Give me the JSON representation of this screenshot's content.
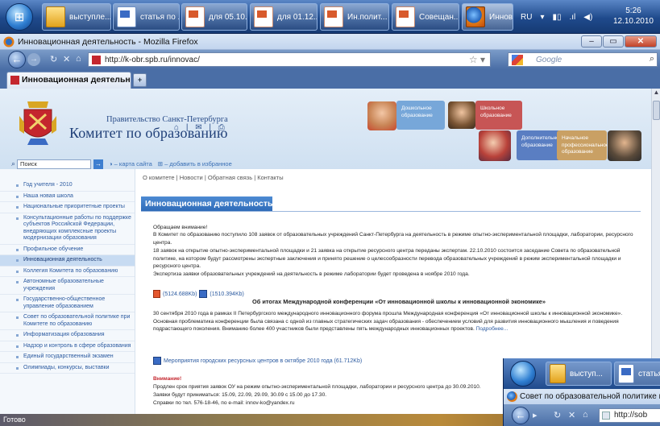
{
  "taskbar": {
    "items": [
      {
        "label": "выступле...",
        "icon": "folder-icon"
      },
      {
        "label": "статья по ...",
        "icon": "word-doc-icon"
      },
      {
        "label": "для 05.10...",
        "icon": "powerpoint-icon"
      },
      {
        "label": "для 01.12...",
        "icon": "powerpoint-icon"
      },
      {
        "label": "Ин.полит...",
        "icon": "powerpoint-icon"
      },
      {
        "label": "Совещан...",
        "icon": "powerpoint-icon"
      },
      {
        "label": "Инновац...",
        "icon": "firefox-icon"
      }
    ],
    "lang": "RU",
    "time": "5:26",
    "date": "12.10.2010"
  },
  "window": {
    "title": "Инновационная деятельность - Mozilla Firefox",
    "url": "http://k-obr.spb.ru/innovac/",
    "search_placeholder": "Google",
    "tab_label": "Инновационная деятельно...",
    "status": "Готово"
  },
  "site": {
    "gov": "Правительство Санкт-Петербурга",
    "committee": "Комитет по образованию",
    "header_icons": "⌂ | ✉ | ⎙",
    "search_value": "Поиск",
    "sitemap": "– карта сайта",
    "favorites": "– добавить в избранное",
    "boxes": [
      "Дошкольное образование",
      "Школьное образование",
      "Дополнительное образование",
      "Начальное профессиональное образование"
    ],
    "topnav": "О комитете | Новости | Обратная связь | Контакты",
    "sidebar": [
      "Год учителя - 2010",
      "Наша новая школа",
      "Национальные приоритетные проекты",
      "Консультационные работы по поддержке субъектов Российской Федерации, внедряющих комплексные проекты модернизации образования",
      "Профильное обучение",
      "Инновационная деятельность",
      "Коллегия Комитета по образованию",
      "Автономные образовательные учреждения",
      "Государственно-общественное управление образованием",
      "Совет по образовательной политике при Комитете по образованию",
      "Информатизация образования",
      "Надзор и контроль в сфере образования",
      "Единый государственный экзамен",
      "Олимпиады, конкурсы, выставки"
    ],
    "active_index": 5,
    "page_title": "Инновационная деятельность",
    "attention": "Обращаем внимание!",
    "p1": "В Комитет по образованию поступило 108 заявок от образовательных учреждений Санкт-Петербурга на деятельность в режиме опытно-экспериментальной площадки, лаборатории, ресурсного центра.",
    "p2": "18 заявок на открытие опытно-экспериментальной площадки и 21 заявка на открытие ресурсного центра переданы экспертам. 22.10.2010 состоится заседание Совета по образовательной политике, на котором будут рассмотрены экспертные заключения и принято решение о целесообразности перевода образовательных учреждений в режим экспериментальной площадки и ресурсного центра.",
    "p3": "Экспертиза заявки образовательных учреждений на деятельность в режиме лаборатории будет проведена в ноябре 2010 года.",
    "file1": "(5124.688Kb)",
    "file2": "(1510.394Kb)",
    "conf_title": "Об итогах Международной конференции «От инновационной школы к инновационной экономике»",
    "conf_text": "30 сентября 2010 года в рамках II Петербургского международного инновационного форума прошла Международная конференция «От инновационной школы к инновационной экономике». Основная проблематика конференции была связана с одной из главных стратегических задач образования - обеспечением условий для развития инновационного мышления и поведения подрастающего поколения. Вниманию более 400 участников были представлены пять международных инновационных проектов.",
    "more": "Подробнее...",
    "events_link": "Мероприятия городских ресурсных центров в октябре 2010 года (61.712Kb)",
    "attention2": "Внимание!",
    "deadline": "Продлен срок приятия заявок ОУ на режим опытно-экспериментальной площадки, лаборатории и ресурсного центра до 30.09.2010.",
    "dates": "Заявки будут приниматься: 15.09, 22.09, 29.09, 30.09 с 15.00 до 17.30.",
    "contact": "Справки по тел. 576-18-46, по e-mail: innov-ko@yandex.ru"
  },
  "overlay": {
    "items": [
      "выступ...",
      "статья"
    ],
    "title": "Совет по образовательной политике п",
    "url": "http://sob"
  }
}
